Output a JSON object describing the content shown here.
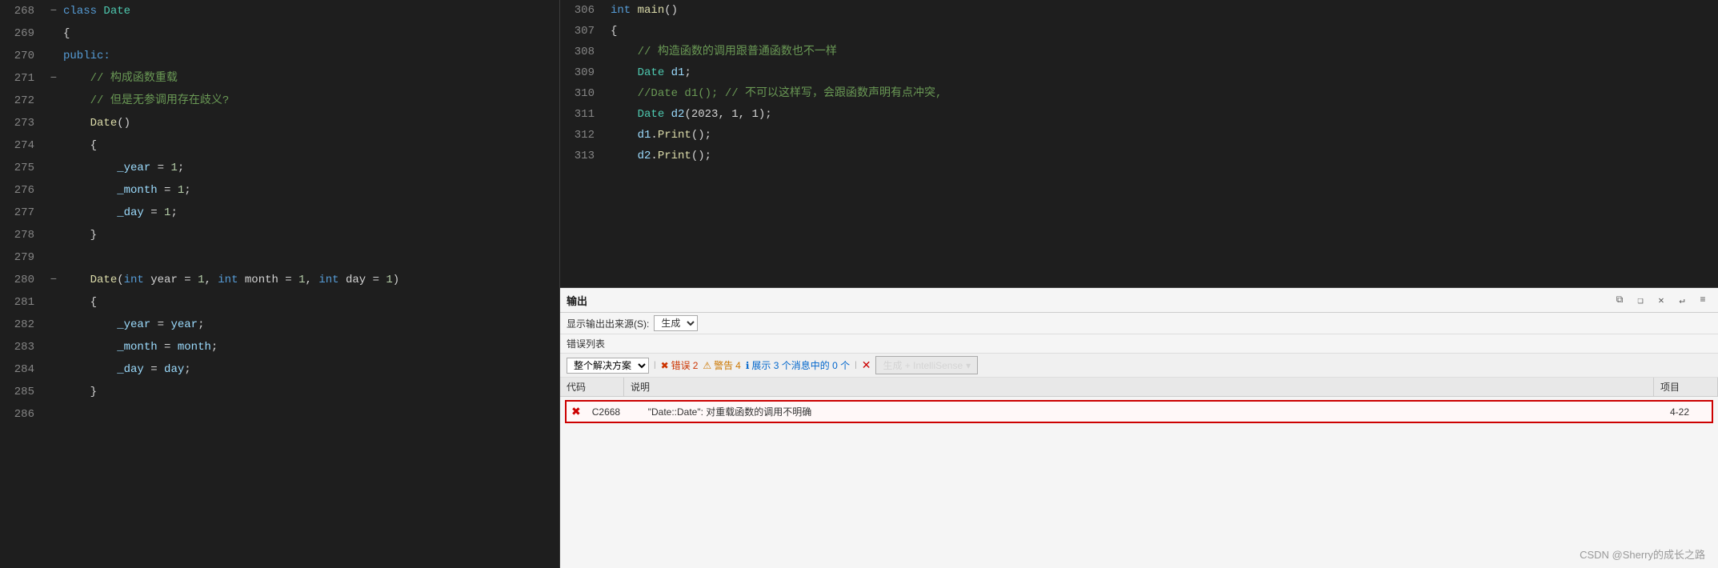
{
  "editor": {
    "left_lines": [
      {
        "num": "268",
        "gutter": "⊟",
        "indent": "",
        "content_parts": [
          {
            "text": "class ",
            "cls": "kw-blue"
          },
          {
            "text": "Date",
            "cls": "kw-class"
          }
        ]
      },
      {
        "num": "269",
        "gutter": "",
        "indent": "",
        "content_parts": [
          {
            "text": "{",
            "cls": "punctuation"
          }
        ]
      },
      {
        "num": "270",
        "gutter": "",
        "indent": "",
        "content_parts": [
          {
            "text": "public:",
            "cls": "kw-public"
          }
        ]
      },
      {
        "num": "271",
        "gutter": "⊟",
        "indent": "    ",
        "content_parts": [
          {
            "text": "// 构成函数重载",
            "cls": "comment"
          }
        ]
      },
      {
        "num": "272",
        "gutter": "",
        "indent": "    ",
        "content_parts": [
          {
            "text": "// 但是无参调用存在歧义?",
            "cls": "comment"
          }
        ]
      },
      {
        "num": "273",
        "gutter": "",
        "indent": "    ",
        "content_parts": [
          {
            "text": "Date",
            "cls": "func-name"
          },
          {
            "text": "()",
            "cls": "punctuation"
          }
        ]
      },
      {
        "num": "274",
        "gutter": "",
        "indent": "    ",
        "content_parts": [
          {
            "text": "{",
            "cls": "punctuation"
          }
        ]
      },
      {
        "num": "275",
        "gutter": "",
        "indent": "        ",
        "content_parts": [
          {
            "text": "_year",
            "cls": "identifier"
          },
          {
            "text": " = ",
            "cls": "punctuation"
          },
          {
            "text": "1",
            "cls": "number"
          },
          {
            "text": ";",
            "cls": "punctuation"
          }
        ]
      },
      {
        "num": "276",
        "gutter": "",
        "indent": "        ",
        "content_parts": [
          {
            "text": "_month",
            "cls": "identifier"
          },
          {
            "text": " = ",
            "cls": "punctuation"
          },
          {
            "text": "1",
            "cls": "number"
          },
          {
            "text": ";",
            "cls": "punctuation"
          }
        ]
      },
      {
        "num": "277",
        "gutter": "",
        "indent": "        ",
        "content_parts": [
          {
            "text": "_day",
            "cls": "identifier"
          },
          {
            "text": " = ",
            "cls": "punctuation"
          },
          {
            "text": "1",
            "cls": "number"
          },
          {
            "text": ";",
            "cls": "punctuation"
          }
        ]
      },
      {
        "num": "278",
        "gutter": "",
        "indent": "    ",
        "content_parts": [
          {
            "text": "}",
            "cls": "punctuation"
          }
        ]
      },
      {
        "num": "279",
        "gutter": "",
        "indent": "",
        "content_parts": []
      },
      {
        "num": "280",
        "gutter": "⊟",
        "indent": "    ",
        "content_parts": [
          {
            "text": "Date",
            "cls": "func-name"
          },
          {
            "text": "(",
            "cls": "punctuation"
          },
          {
            "text": "int",
            "cls": "kw-blue"
          },
          {
            "text": " year = ",
            "cls": "punctuation"
          },
          {
            "text": "1",
            "cls": "number"
          },
          {
            "text": ", ",
            "cls": "punctuation"
          },
          {
            "text": "int",
            "cls": "kw-blue"
          },
          {
            "text": " month = ",
            "cls": "punctuation"
          },
          {
            "text": "1",
            "cls": "number"
          },
          {
            "text": ", ",
            "cls": "punctuation"
          },
          {
            "text": "int",
            "cls": "kw-blue"
          },
          {
            "text": " day = ",
            "cls": "punctuation"
          },
          {
            "text": "1",
            "cls": "number"
          },
          {
            "text": ")",
            "cls": "punctuation"
          }
        ]
      },
      {
        "num": "281",
        "gutter": "",
        "indent": "    ",
        "content_parts": [
          {
            "text": "{",
            "cls": "punctuation"
          }
        ]
      },
      {
        "num": "282",
        "gutter": "",
        "indent": "        ",
        "content_parts": [
          {
            "text": "_year",
            "cls": "identifier"
          },
          {
            "text": " = ",
            "cls": "punctuation"
          },
          {
            "text": "year",
            "cls": "identifier"
          },
          {
            "text": ";",
            "cls": "punctuation"
          }
        ]
      },
      {
        "num": "283",
        "gutter": "",
        "indent": "        ",
        "content_parts": [
          {
            "text": "_month",
            "cls": "identifier"
          },
          {
            "text": " = ",
            "cls": "punctuation"
          },
          {
            "text": "month",
            "cls": "identifier"
          },
          {
            "text": ";",
            "cls": "punctuation"
          }
        ]
      },
      {
        "num": "284",
        "gutter": "",
        "indent": "        ",
        "content_parts": [
          {
            "text": "_day",
            "cls": "identifier"
          },
          {
            "text": " = ",
            "cls": "punctuation"
          },
          {
            "text": "day",
            "cls": "identifier"
          },
          {
            "text": ";",
            "cls": "punctuation"
          }
        ]
      },
      {
        "num": "285",
        "gutter": "",
        "indent": "    ",
        "content_parts": [
          {
            "text": "}",
            "cls": "punctuation"
          }
        ]
      },
      {
        "num": "286",
        "gutter": "",
        "indent": "",
        "content_parts": []
      }
    ],
    "right_lines": [
      {
        "num": "306",
        "gutter": "",
        "indent": "",
        "content_parts": [
          {
            "text": "int",
            "cls": "kw-blue"
          },
          {
            "text": " ",
            "cls": "punctuation"
          },
          {
            "text": "main",
            "cls": "func-name"
          },
          {
            "text": "()",
            "cls": "punctuation"
          }
        ]
      },
      {
        "num": "307",
        "gutter": "",
        "indent": "",
        "content_parts": [
          {
            "text": "{",
            "cls": "punctuation"
          }
        ]
      },
      {
        "num": "308",
        "gutter": "",
        "indent": "    ",
        "content_parts": [
          {
            "text": "// 构造函数的调用跟普通函数也不一样",
            "cls": "comment"
          }
        ]
      },
      {
        "num": "309",
        "gutter": "",
        "indent": "    ",
        "content_parts": [
          {
            "text": "Date",
            "cls": "kw-class"
          },
          {
            "text": " ",
            "cls": "punctuation"
          },
          {
            "text": "d1",
            "cls": "identifier"
          },
          {
            "text": ";",
            "cls": "punctuation"
          }
        ]
      },
      {
        "num": "310",
        "gutter": "",
        "indent": "    ",
        "content_parts": [
          {
            "text": "//Date d1(); // 不可以这样写，会跟函数声明有点冲突,",
            "cls": "comment"
          }
        ]
      },
      {
        "num": "311",
        "gutter": "",
        "indent": "    ",
        "content_parts": [
          {
            "text": "Date",
            "cls": "kw-class"
          },
          {
            "text": " ",
            "cls": "punctuation"
          },
          {
            "text": "d2",
            "cls": "identifier"
          },
          {
            "text": "(2023, 1, 1);",
            "cls": "punctuation"
          }
        ]
      },
      {
        "num": "312",
        "gutter": "",
        "indent": "    ",
        "content_parts": [
          {
            "text": "d1",
            "cls": "identifier"
          },
          {
            "text": ".",
            "cls": "punctuation"
          },
          {
            "text": "Print",
            "cls": "func-name"
          },
          {
            "text": "();",
            "cls": "punctuation"
          }
        ]
      },
      {
        "num": "313",
        "gutter": "",
        "indent": "    ",
        "content_parts": [
          {
            "text": "d2",
            "cls": "identifier"
          },
          {
            "text": ".",
            "cls": "punctuation"
          },
          {
            "text": "Print",
            "cls": "func-name"
          },
          {
            "text": "();",
            "cls": "punctuation"
          }
        ]
      }
    ]
  },
  "output_panel": {
    "title": "输出",
    "source_label": "显示输出出来源(S):",
    "source_value": "生成",
    "toolbar_icons": [
      "copy",
      "copy-all",
      "clear",
      "word-wrap",
      "options"
    ]
  },
  "error_panel": {
    "title": "错误列表",
    "filter_label": "整个解决方案",
    "error_count": "2",
    "warning_count": "4",
    "info_count": "0",
    "info_label": "展示 3 个消息中的 0 个",
    "generate_button": "生成 + IntelliSense",
    "columns": {
      "code": "代码",
      "desc": "说明",
      "project": "项目"
    },
    "errors": [
      {
        "icon": "✖",
        "code": "C2668",
        "description": "\"Date::Date\": 对重载函数的调用不明确",
        "project": "4-22"
      }
    ]
  },
  "watermark": "CSDN @Sherry的成长之路"
}
